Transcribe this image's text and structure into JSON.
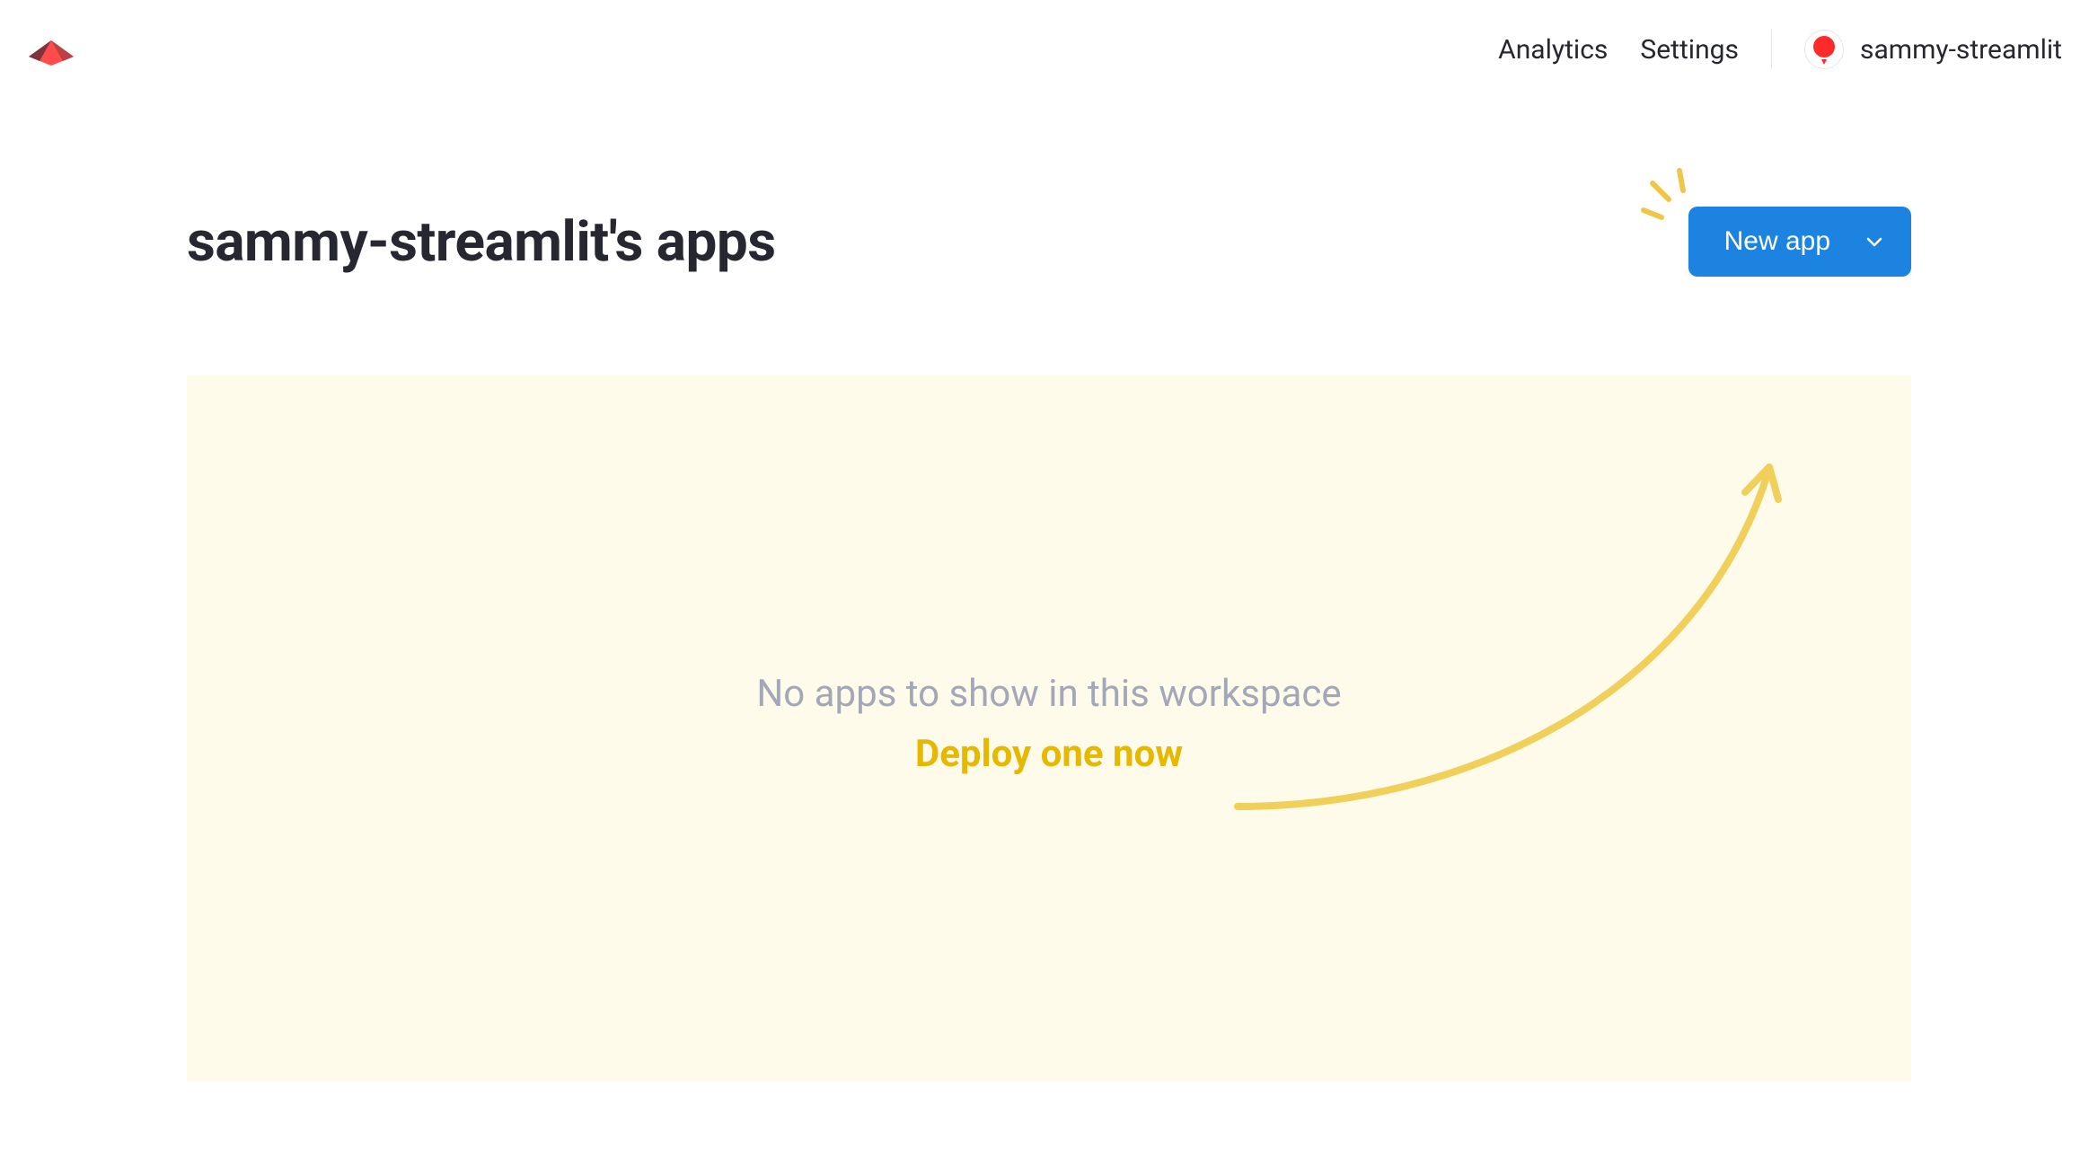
{
  "nav": {
    "analytics": "Analytics",
    "settings": "Settings",
    "username": "sammy-streamlit"
  },
  "page": {
    "title": "sammy-streamlit's apps"
  },
  "actions": {
    "new_app": "New app"
  },
  "empty": {
    "message": "No apps to show in this workspace",
    "cta": "Deploy one now"
  }
}
